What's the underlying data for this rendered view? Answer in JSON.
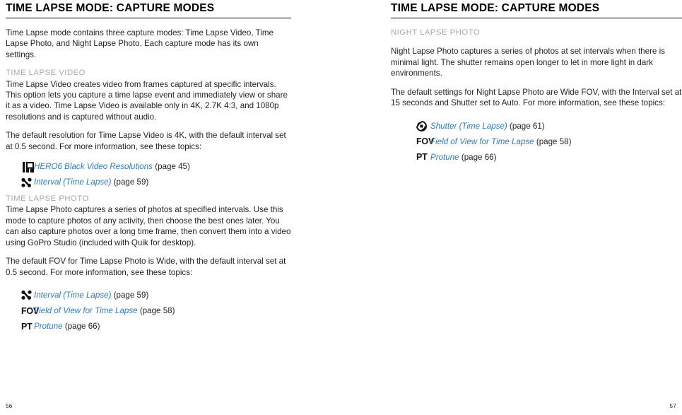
{
  "document": {
    "left_page": {
      "title": "TIME LAPSE MODE: CAPTURE MODES",
      "intro": "Time Lapse mode contains three capture modes: Time Lapse Video, Time Lapse Photo, and Night Lapse Photo. Each capture mode has its own settings.",
      "sections": [
        {
          "heading": "TIME LAPSE VIDEO",
          "body": "Time Lapse Video creates video from frames captured at specific intervals. This option lets you capture a time lapse event and immediately view or share it as a video. Time Lapse Video is available only in 4K, 2.7K 4:3, and 1080p resolutions and is captured without audio.",
          "body2": "The default resolution for Time Lapse Video is 4K, with the default interval set at 0.5 second. For more information, see these topics:",
          "links": [
            {
              "icon": "video-resolutions-icon",
              "icon_text": "",
              "link": "HERO6 Black Video Resolutions",
              "page_ref": "(page 45)"
            },
            {
              "icon": "interval-icon",
              "icon_text": "",
              "link": "Interval (Time Lapse)",
              "page_ref": "(page 59)"
            }
          ]
        },
        {
          "heading": "TIME LAPSE PHOTO",
          "body": "Time Lapse Photo captures a series of photos at specified intervals. Use this mode to capture photos of any activity, then choose the best ones later. You can also capture photos over a long time frame, then convert them into a video using GoPro Studio (included with Quik for desktop).",
          "body2": "The default FOV for Time Lapse Photo is Wide, with the default interval set at 0.5 second. For more information, see these topics:",
          "links": [
            {
              "icon": "interval-icon",
              "icon_text": "",
              "link": "Interval (Time Lapse)",
              "page_ref": "(page 59)"
            },
            {
              "icon": "fov-icon",
              "icon_text": "FOV",
              "link": "Field of View for Time Lapse",
              "page_ref": "(page 58)"
            },
            {
              "icon": "protune-icon",
              "icon_text": "PT",
              "link": "Protune",
              "page_ref": "(page 66)"
            }
          ]
        }
      ],
      "folio": "56"
    },
    "right_page": {
      "title": "TIME LAPSE MODE: CAPTURE MODES",
      "sections": [
        {
          "heading": "NIGHT LAPSE PHOTO",
          "body": "Night Lapse Photo captures a series of photos at set intervals when there is minimal light. The shutter remains open longer to let in more light in dark environments.",
          "body2": "The default settings for Night Lapse Photo are Wide FOV, with the Interval set at 15 seconds and Shutter set to Auto. For more information, see these topics:",
          "links": [
            {
              "icon": "shutter-icon",
              "icon_text": "",
              "link": "Shutter (Time Lapse)",
              "page_ref": "(page 61)"
            },
            {
              "icon": "fov-icon",
              "icon_text": "FOV",
              "link": "Field of View for Time Lapse",
              "page_ref": "(page 58)"
            },
            {
              "icon": "protune-icon",
              "icon_text": "PT",
              "link": "Protune",
              "page_ref": "(page 66)"
            }
          ]
        }
      ],
      "folio": "57"
    }
  },
  "colors": {
    "link": "#2e7bc0",
    "section_heading": "#a7a9ac",
    "body": "#231f20",
    "rule": "#000000"
  }
}
